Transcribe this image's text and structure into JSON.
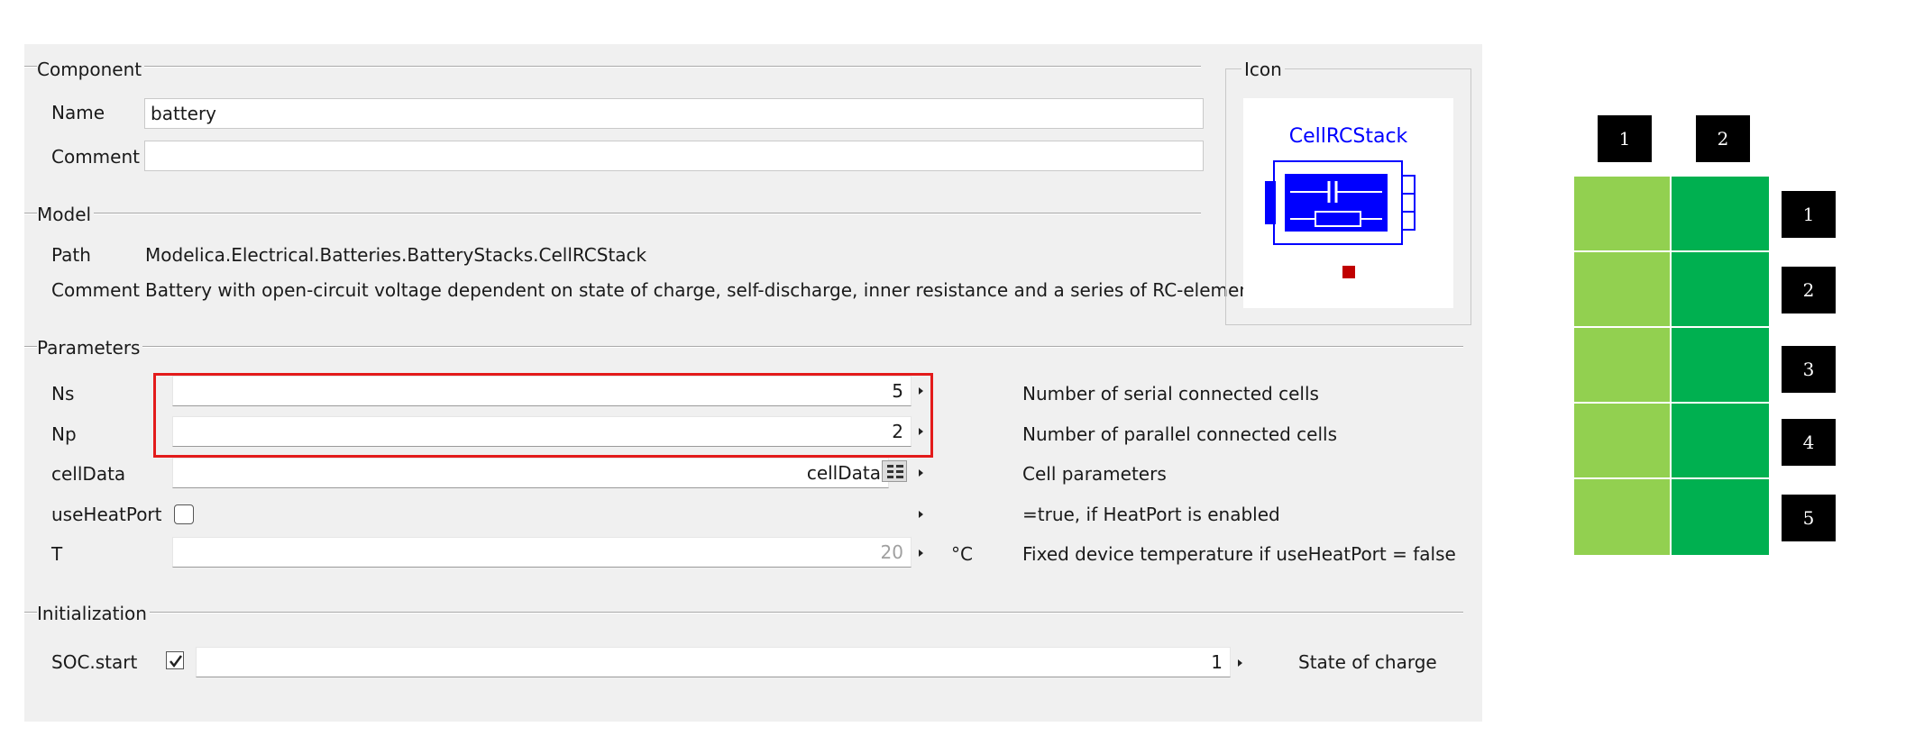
{
  "component": {
    "title": "Component",
    "name_label": "Name",
    "name_value": "battery",
    "comment_label": "Comment",
    "comment_value": ""
  },
  "icon": {
    "title": "Icon",
    "caption": "CellRCStack"
  },
  "model": {
    "title": "Model",
    "path_label": "Path",
    "path_value": "Modelica.Electrical.Batteries.BatteryStacks.CellRCStack",
    "comment_label": "Comment",
    "comment_value": "Battery with open-circuit voltage dependent on state of charge, self-discharge, inner resistance and a series of RC-elements"
  },
  "parameters": {
    "title": "Parameters",
    "rows": [
      {
        "label": "Ns",
        "value": "5",
        "unit": "",
        "description": "Number of serial connected cells"
      },
      {
        "label": "Np",
        "value": "2",
        "unit": "",
        "description": "Number of parallel connected cells"
      },
      {
        "label": "cellData",
        "value": "cellData",
        "unit": "",
        "description": "Cell parameters"
      },
      {
        "label": "useHeatPort",
        "value": "",
        "unit": "",
        "description": "=true, if HeatPort is enabled"
      },
      {
        "label": "T",
        "value": "20",
        "unit": "°C",
        "description": "Fixed device temperature if useHeatPort = false"
      }
    ]
  },
  "initialization": {
    "title": "Initialization",
    "soc_label": "SOC.start",
    "soc_value": "1",
    "soc_description": "State of charge"
  },
  "cell_grid": {
    "column_labels": [
      "1",
      "2"
    ],
    "row_labels": [
      "1",
      "2",
      "3",
      "4",
      "5"
    ],
    "column_colors": [
      "#92d050",
      "#00b050"
    ]
  },
  "colors": {
    "highlight": "#e31b1b",
    "icon_blue": "#0000ff",
    "dialog_bg": "#f0f0f0"
  }
}
